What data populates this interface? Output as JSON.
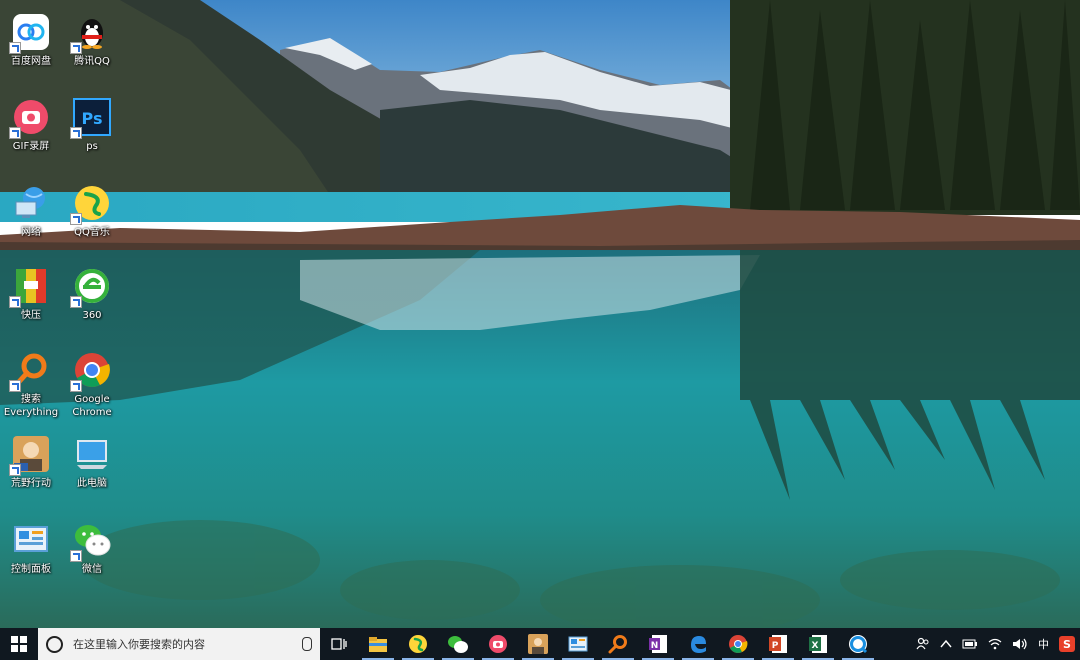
{
  "desktop": {
    "icons": [
      {
        "label": "百度网盘",
        "icon": "baidu-netdisk-icon"
      },
      {
        "label": "腾讯QQ",
        "icon": "qq-penguin-icon"
      },
      {
        "label": "GIF录屏",
        "icon": "gif-recorder-icon"
      },
      {
        "label": "ps",
        "icon": "photoshop-icon"
      },
      {
        "label": "网络",
        "icon": "network-icon"
      },
      {
        "label": "QQ音乐",
        "icon": "qq-music-icon"
      },
      {
        "label": "快压",
        "icon": "kuaiya-icon"
      },
      {
        "label": "360",
        "icon": "browser-360-icon"
      },
      {
        "label": "搜索\nEverything",
        "icon": "everything-search-icon"
      },
      {
        "label": "Google\nChrome",
        "icon": "chrome-icon"
      },
      {
        "label": "荒野行动",
        "icon": "game-icon"
      },
      {
        "label": "此电脑",
        "icon": "this-pc-icon"
      },
      {
        "label": "控制面板",
        "icon": "control-panel-icon"
      },
      {
        "label": "微信",
        "icon": "wechat-icon"
      }
    ]
  },
  "taskbar": {
    "search_placeholder": "在这里输入你要搜索的内容",
    "apps": [
      {
        "icon": "file-explorer-icon"
      },
      {
        "icon": "qq-music-icon"
      },
      {
        "icon": "wechat-icon"
      },
      {
        "icon": "gif-recorder-icon"
      },
      {
        "icon": "game-icon"
      },
      {
        "icon": "control-panel-icon"
      },
      {
        "icon": "everything-search-icon"
      },
      {
        "icon": "onenote-icon"
      },
      {
        "icon": "edge-icon"
      },
      {
        "icon": "chrome-icon"
      },
      {
        "icon": "powerpoint-icon"
      },
      {
        "icon": "excel-icon"
      },
      {
        "icon": "browser-icon"
      }
    ],
    "tray": {
      "ime_label": "中",
      "ime_brand": "S"
    }
  },
  "colors": {
    "taskbar": "#101820",
    "accent": "#2a6fd6"
  }
}
